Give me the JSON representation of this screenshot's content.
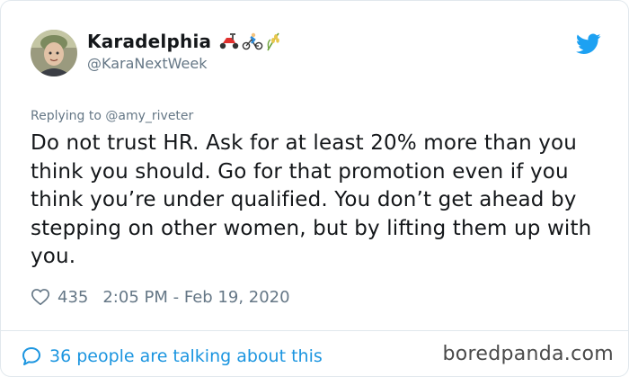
{
  "author": {
    "display_name": "Karadelphia",
    "handle": "@KaraNextWeek",
    "name_emojis": [
      "scooter-emoji",
      "cyclist-emoji",
      "rice-emoji"
    ]
  },
  "reply": {
    "prefix": "Replying to",
    "mention": "@amy_riveter"
  },
  "tweet": {
    "text": "Do not trust HR. Ask for at least 20% more than you think you should. Go for that promotion even if you think you’re under qualified. You don’t get ahead by stepping on other women, but by lifting them up with you."
  },
  "stats": {
    "likes": "435",
    "timestamp": "2:05 PM - Feb 19, 2020"
  },
  "footer": {
    "conversation": "36 people are talking about this"
  },
  "watermark": "boredpanda.com",
  "colors": {
    "link_blue": "#1b95e0",
    "twitter_blue": "#1da1f2",
    "muted_gray": "#657786"
  },
  "icons": {
    "brand": "twitter-bird-icon",
    "like": "heart-icon",
    "comments": "speech-bubble-icon"
  }
}
